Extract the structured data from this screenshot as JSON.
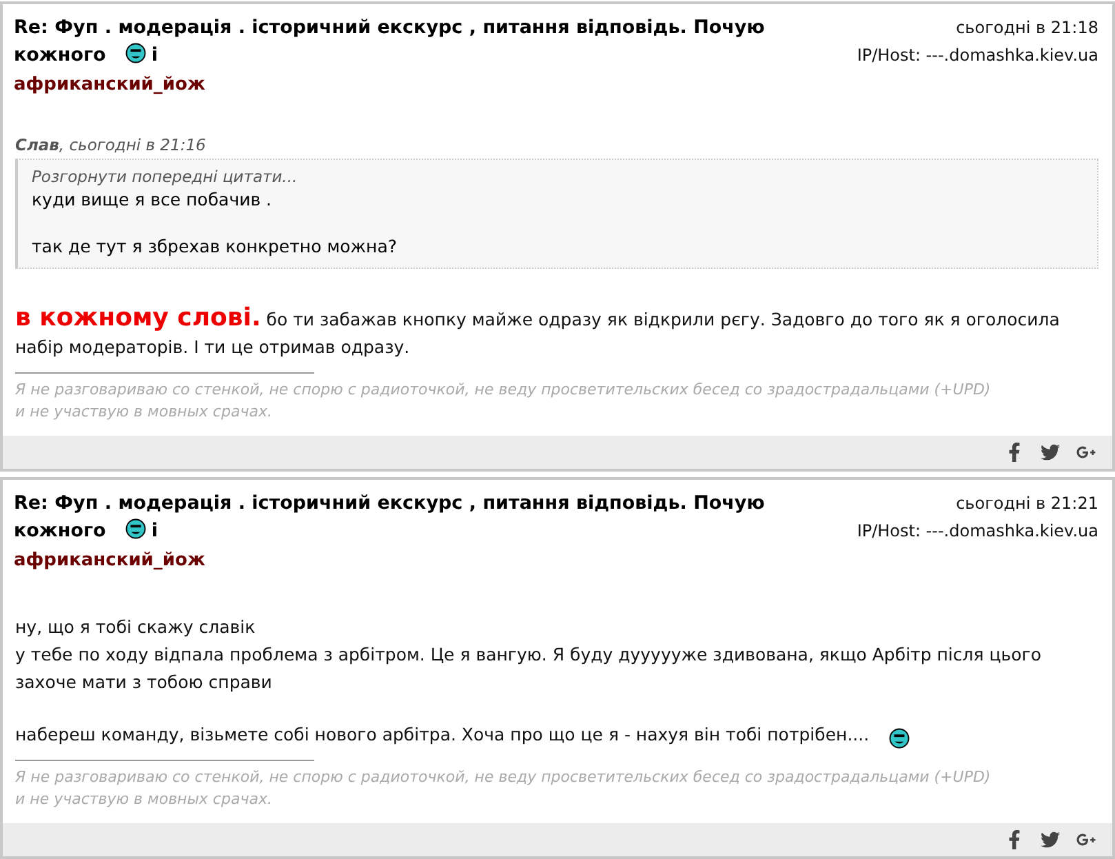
{
  "posts": [
    {
      "title": "Re: Фуп . модерація . історичний екскурс , питання відповідь. Почую",
      "title_line2": "кожного",
      "title_end": "і",
      "author": "африканский_йож",
      "time": "сьогодні в 21:18",
      "host": "IP/Host: ---.domashka.kiev.ua",
      "quote": {
        "author": "Слав",
        "time": ", сьогодні в 21:16",
        "expand": "Розгорнути попередні цитати...",
        "paragraphs": [
          "куди вище я все побачив .",
          "так де тут я збрехав конкретно можна?"
        ]
      },
      "body": [
        {
          "lead": "в кожному слові.",
          "text": " бо ти забажав кнопку майже одразу як відкрили рєгу. Задовго до того як я оголосила набір модераторів. І ти це отримав одразу.",
          "emoticon": false
        }
      ],
      "signature": "Я не разговариваю со стенкой, не спорю с радиоточкой, не веду просветительских бесед со зрадострадальцами  (+UPD)\nи не участвую в мовных срачах."
    },
    {
      "title": "Re: Фуп . модерація . історичний екскурс , питання відповідь. Почую",
      "title_line2": "кожного",
      "title_end": "і",
      "author": "африканский_йож",
      "time": "сьогодні в 21:21",
      "host": "IP/Host: ---.domashka.kiev.ua",
      "body": [
        {
          "text": "ну, що я тобі скажу славік\nу тебе по ходу відпала проблема з арбітром. Це я вангую. Я буду дуууууже здивована, якщо Арбітр після цього захоче мати з тобою справи",
          "emoticon": false
        },
        {
          "text": "набереш команду, візьмете собі нового арбітра. Хоча про що це я - нахуя він тобі потрібен....",
          "emoticon": true
        }
      ],
      "signature": "Я не разговариваю со стенкой, не спорю с радиоточкой, не веду просветительских бесед со зрадострадальцами  (+UPD)\nи не участвую в мовных срачах."
    }
  ]
}
